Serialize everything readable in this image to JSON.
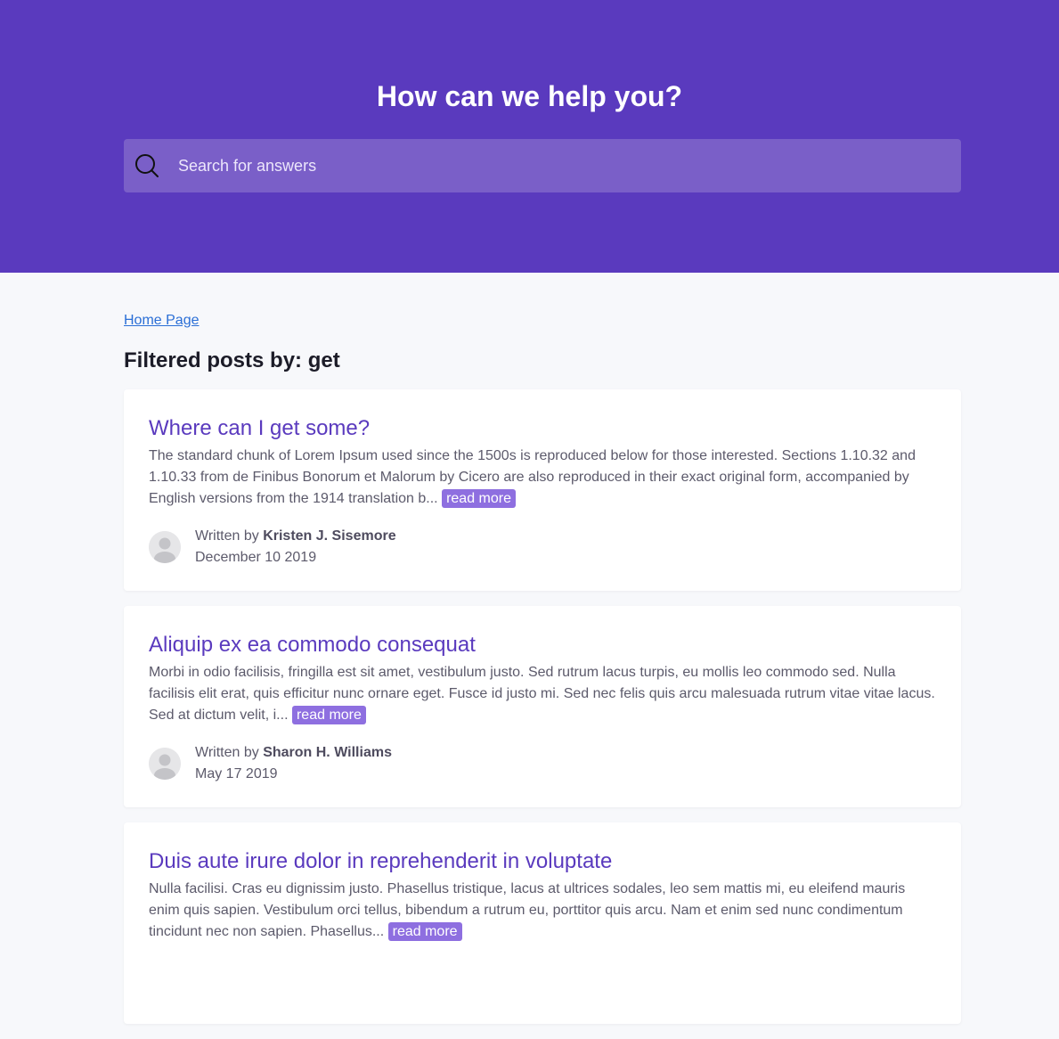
{
  "header": {
    "title": "How can we help you?",
    "search_placeholder": "Search for answers"
  },
  "breadcrumb": {
    "home": "Home Page"
  },
  "filter": {
    "title": "Filtered posts by: get"
  },
  "posts": [
    {
      "title": "Where can I get some?",
      "excerpt": "The standard chunk of Lorem Ipsum used since the 1500s is reproduced below for those interested. Sections 1.10.32 and 1.10.33 from de Finibus Bonorum et Malorum by Cicero are also reproduced in their exact original form, accompanied by English versions from the 1914 translation b...",
      "read_more": "read more",
      "written_by": "Written by",
      "author": "Kristen J. Sisemore",
      "date": "December 10 2019"
    },
    {
      "title": "Aliquip ex ea commodo consequat",
      "excerpt": "Morbi in odio facilisis, fringilla est sit amet, vestibulum justo. Sed rutrum lacus turpis, eu mollis leo commodo sed. Nulla facilisis elit erat, quis efficitur nunc ornare eget. Fusce id justo mi. Sed nec felis quis arcu malesuada rutrum vitae vitae lacus. Sed at dictum velit, i...",
      "read_more": "read more",
      "written_by": "Written by",
      "author": "Sharon H. Williams",
      "date": "May 17 2019"
    },
    {
      "title": "Duis aute irure dolor in reprehenderit in voluptate",
      "excerpt": "Nulla facilisi. Cras eu dignissim justo. Phasellus tristique, lacus at ultrices sodales, leo sem mattis mi, eu eleifend mauris enim quis sapien. Vestibulum orci tellus, bibendum a rutrum eu, porttitor quis arcu. Nam et enim sed nunc condimentum tincidunt nec non sapien. Phasellus...",
      "read_more": "read more"
    }
  ],
  "colors": {
    "brand": "#5a3abe",
    "search_bg": "#7a5fc8",
    "read_more_bg": "#8e6fe0",
    "page_bg": "#f7f8fb",
    "link": "#2b6fd6"
  },
  "icons": {
    "search": "search-icon",
    "avatar": "user-avatar-icon"
  }
}
